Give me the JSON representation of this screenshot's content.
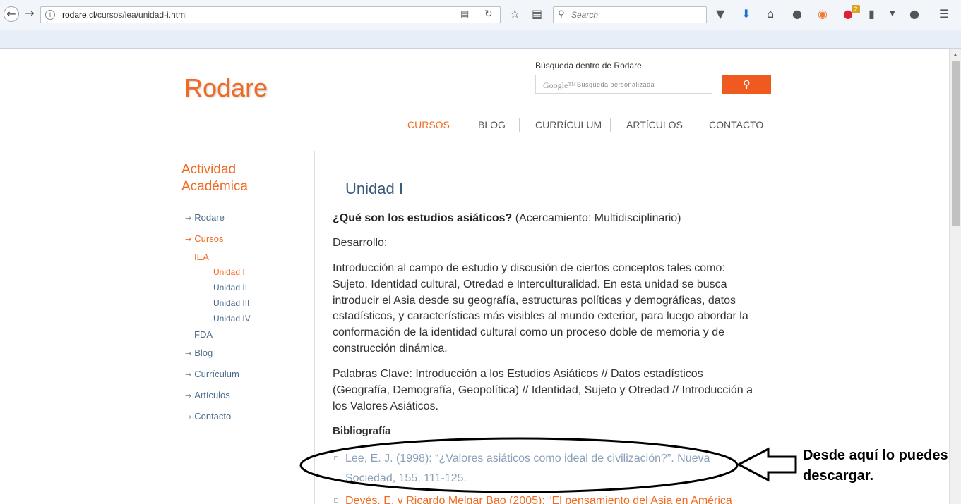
{
  "browser": {
    "url_domain": "rodare.cl",
    "url_path": "/cursos/iea/unidad-i.html",
    "search_placeholder": "Search",
    "downloads_badge": "2"
  },
  "header": {
    "logo": "Rodare",
    "search_label": "Búsqueda dentro de Rodare",
    "search_google": "Google™",
    "search_placeholder": "Búsqueda personalizada"
  },
  "nav": [
    "CURSOS",
    "BLOG",
    "CURRÍCULUM",
    "ARTÍCULOS",
    "CONTACTO"
  ],
  "sidebar": {
    "title_line1": "Actividad",
    "title_line2": "Académica",
    "items": [
      "Rodare",
      "Cursos",
      "IEA",
      "Unidad I",
      "Unidad II",
      "Unidad III",
      "Unidad IV",
      "FDA",
      "Blog",
      "Currículum",
      "Artículos",
      "Contacto"
    ]
  },
  "content": {
    "title": "Unidad I",
    "q_bold": "¿Qué son los estudios asiáticos?",
    "q_rest": " (Acercamiento: Multidisciplinario)",
    "desarrollo": "Desarrollo:",
    "intro": "Introducción al campo de estudio y discusión de ciertos conceptos tales como: Sujeto, Identidad cultural, Otredad e Interculturalidad. En esta unidad se busca introducir el Asia desde su geografía, estructuras políticas y demográficas, datos estadísticos, y características más visibles al mundo exterior, para luego abordar la conformación de la identidad cultural como un proceso doble de memoria y de construcción dinámica.",
    "keywords": "Palabras Clave: Introducción a los Estudios Asiáticos // Datos estadísticos (Geografía, Demografía, Geopolítica) // Identidad, Sujeto y Otredad // Introducción a los Valores Asiáticos.",
    "biblio_heading": "Bibliografía",
    "bib1": "Lee, E. J. (1998): “¿Valores asiáticos como ideal de civilización?”. Nueva Sociedad, 155, 111-125.",
    "bib2": "Devés, E. y Ricardo Melgar Bao (2005): “El pensamiento del Asia en América"
  },
  "annotation": {
    "line1": "Desde aquí lo puedes",
    "line2": "descargar."
  }
}
